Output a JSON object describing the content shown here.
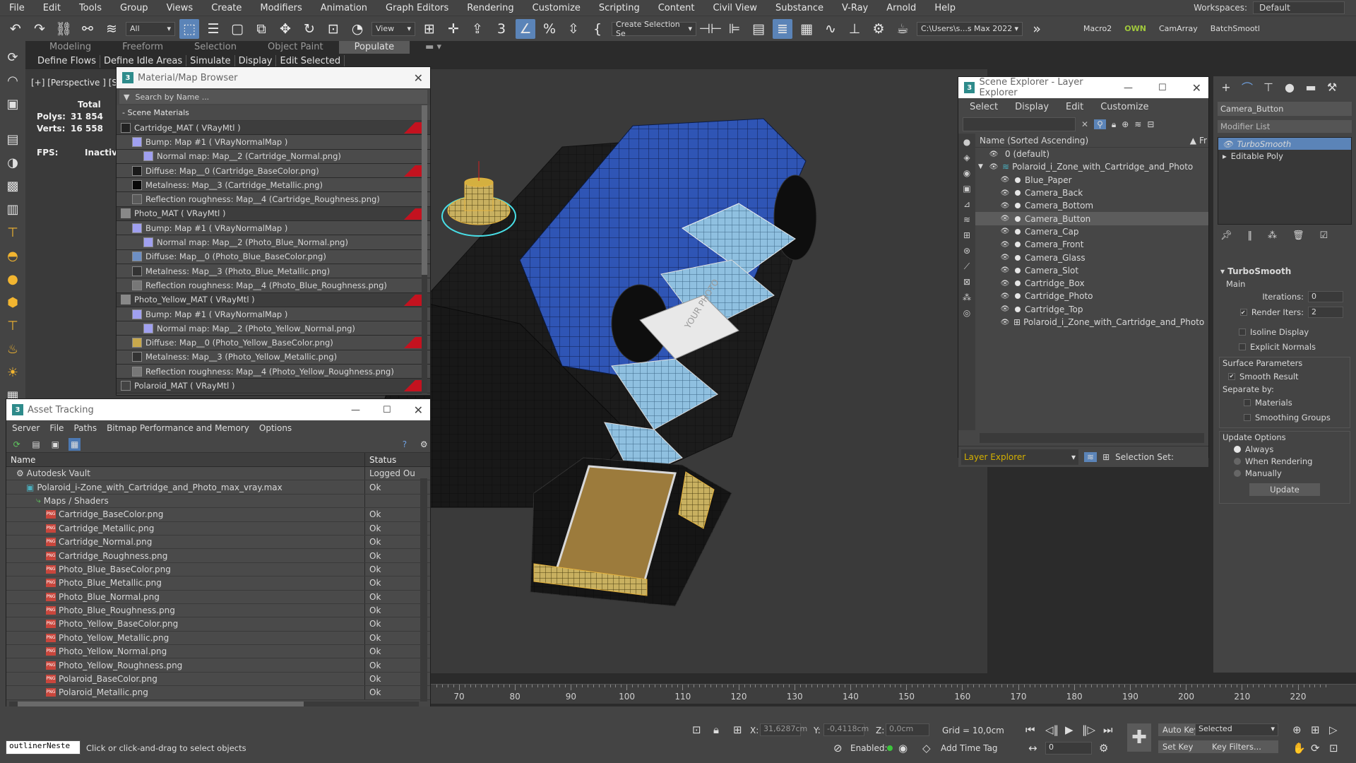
{
  "menubar": {
    "items": [
      "File",
      "Edit",
      "Tools",
      "Group",
      "Views",
      "Create",
      "Modifiers",
      "Animation",
      "Graph Editors",
      "Rendering",
      "Customize",
      "Scripting",
      "Content",
      "Civil View",
      "Substance",
      "V-Ray",
      "Arnold",
      "Help"
    ],
    "workspaces_label": "Workspaces:",
    "workspaces_value": "Default"
  },
  "toolbar": {
    "filter_value": "All",
    "view_value": "View",
    "selection_set": "Create Selection Se",
    "project_path": "C:\\Users\\s...s Max 2022",
    "macro2": "Macro2",
    "own": "OWN",
    "camarray": "CamArray",
    "batchsmooth": "BatchSmootl"
  },
  "ribbon": {
    "tabs": [
      "Modeling",
      "Freeform",
      "Selection",
      "Object Paint",
      "Populate"
    ],
    "sub_items": [
      "Define Flows",
      "Define Idle Areas",
      "Simulate",
      "Display",
      "Edit Selected"
    ]
  },
  "viewport": {
    "label": "[+] [Perspective ] [St",
    "stats": {
      "total_label": "Total",
      "polys_label": "Polys:",
      "polys_value": "31 854",
      "verts_label": "Verts:",
      "verts_value": "16 558",
      "fps_label": "FPS:",
      "fps_value": "Inactive"
    },
    "photo_text": "YOUR PHOTO"
  },
  "material_browser": {
    "title": "Material/Map Browser",
    "search_placeholder": "Search by Name ...",
    "group": "- Scene Materials",
    "rows": [
      {
        "text": "Cartridge_MAT  ( VRayMtl )",
        "indent": 0,
        "top": true,
        "swatch": "#222222",
        "tag": true
      },
      {
        "text": "Bump: Map #1  ( VRayNormalMap )",
        "indent": 1,
        "swatch": "#a0a0f0"
      },
      {
        "text": "Normal map: Map__2 (Cartridge_Normal.png)",
        "indent": 2,
        "swatch": "#a0a0f0"
      },
      {
        "text": "Diffuse: Map__0 (Cartridge_BaseColor.png)",
        "indent": 1,
        "swatch": "#1a1a1a",
        "tag": true
      },
      {
        "text": "Metalness: Map__3 (Cartridge_Metallic.png)",
        "indent": 1,
        "swatch": "#080808"
      },
      {
        "text": "Reflection roughness: Map__4 (Cartridge_Roughness.png)",
        "indent": 1,
        "swatch": "#5a5a5a"
      },
      {
        "text": "Photo_MAT  ( VRayMtl )",
        "indent": 0,
        "top": true,
        "swatch": "#888888",
        "tag": true
      },
      {
        "text": "Bump: Map #1  ( VRayNormalMap )",
        "indent": 1,
        "swatch": "#a0a0f0"
      },
      {
        "text": "Normal map: Map__2 (Photo_Blue_Normal.png)",
        "indent": 2,
        "swatch": "#a0a0f0"
      },
      {
        "text": "Diffuse: Map__0 (Photo_Blue_BaseColor.png)",
        "indent": 1,
        "swatch": "#6d8fc4"
      },
      {
        "text": "Metalness: Map__3 (Photo_Blue_Metallic.png)",
        "indent": 1,
        "swatch": "#333333"
      },
      {
        "text": "Reflection roughness: Map__4 (Photo_Blue_Roughness.png)",
        "indent": 1,
        "swatch": "#777777"
      },
      {
        "text": "Photo_Yellow_MAT  ( VRayMtl )",
        "indent": 0,
        "top": true,
        "swatch": "#888888",
        "tag": true
      },
      {
        "text": "Bump: Map #1  ( VRayNormalMap )",
        "indent": 1,
        "swatch": "#a0a0f0"
      },
      {
        "text": "Normal map: Map__2 (Photo_Yellow_Normal.png)",
        "indent": 2,
        "swatch": "#a0a0f0"
      },
      {
        "text": "Diffuse: Map__0 (Photo_Yellow_BaseColor.png)",
        "indent": 1,
        "swatch": "#c8a84c",
        "tag": true
      },
      {
        "text": "Metalness: Map__3 (Photo_Yellow_Metallic.png)",
        "indent": 1,
        "swatch": "#333333"
      },
      {
        "text": "Reflection roughness: Map__4 (Photo_Yellow_Roughness.png)",
        "indent": 1,
        "swatch": "#777777"
      },
      {
        "text": "Polaroid_MAT  ( VRayMtl )",
        "indent": 0,
        "top": true,
        "swatch": "#444444",
        "tag": true
      }
    ]
  },
  "asset_tracking": {
    "title": "Asset Tracking",
    "menu": [
      "Server",
      "File",
      "Paths",
      "Bitmap Performance and Memory",
      "Options"
    ],
    "col_name": "Name",
    "col_status": "Status",
    "rows": [
      {
        "name": "Autodesk Vault",
        "status": "Logged Ou",
        "indent": 1,
        "icon": "vault"
      },
      {
        "name": "Polaroid_i-Zone_with_Cartridge_and_Photo_max_vray.max",
        "status": "Ok",
        "indent": 2,
        "icon": "max"
      },
      {
        "name": "Maps / Shaders",
        "status": "",
        "indent": 3,
        "icon": "maps"
      },
      {
        "name": "Cartridge_BaseColor.png",
        "status": "Ok",
        "indent": 4,
        "icon": "png"
      },
      {
        "name": "Cartridge_Metallic.png",
        "status": "Ok",
        "indent": 4,
        "icon": "png"
      },
      {
        "name": "Cartridge_Normal.png",
        "status": "Ok",
        "indent": 4,
        "icon": "png"
      },
      {
        "name": "Cartridge_Roughness.png",
        "status": "Ok",
        "indent": 4,
        "icon": "png"
      },
      {
        "name": "Photo_Blue_BaseColor.png",
        "status": "Ok",
        "indent": 4,
        "icon": "png"
      },
      {
        "name": "Photo_Blue_Metallic.png",
        "status": "Ok",
        "indent": 4,
        "icon": "png"
      },
      {
        "name": "Photo_Blue_Normal.png",
        "status": "Ok",
        "indent": 4,
        "icon": "png"
      },
      {
        "name": "Photo_Blue_Roughness.png",
        "status": "Ok",
        "indent": 4,
        "icon": "png"
      },
      {
        "name": "Photo_Yellow_BaseColor.png",
        "status": "Ok",
        "indent": 4,
        "icon": "png"
      },
      {
        "name": "Photo_Yellow_Metallic.png",
        "status": "Ok",
        "indent": 4,
        "icon": "png"
      },
      {
        "name": "Photo_Yellow_Normal.png",
        "status": "Ok",
        "indent": 4,
        "icon": "png"
      },
      {
        "name": "Photo_Yellow_Roughness.png",
        "status": "Ok",
        "indent": 4,
        "icon": "png"
      },
      {
        "name": "Polaroid_BaseColor.png",
        "status": "Ok",
        "indent": 4,
        "icon": "png"
      },
      {
        "name": "Polaroid_Metallic.png",
        "status": "Ok",
        "indent": 4,
        "icon": "png"
      }
    ]
  },
  "scene_explorer": {
    "title": "Scene Explorer - Layer Explorer",
    "menu": [
      "Select",
      "Display",
      "Edit",
      "Customize"
    ],
    "column_header": "Name (Sorted Ascending)",
    "column_header2": "Fr",
    "rows": [
      {
        "name": "0 (default)",
        "level": 1,
        "selected": false,
        "type": "layer"
      },
      {
        "name": "Polaroid_i_Zone_with_Cartridge_and_Photo",
        "level": 1,
        "selected": false,
        "type": "layer-open"
      },
      {
        "name": "Blue_Paper",
        "level": 2,
        "selected": false,
        "type": "obj"
      },
      {
        "name": "Camera_Back",
        "level": 2,
        "selected": false,
        "type": "obj"
      },
      {
        "name": "Camera_Bottom",
        "level": 2,
        "selected": false,
        "type": "obj"
      },
      {
        "name": "Camera_Button",
        "level": 2,
        "selected": true,
        "type": "obj"
      },
      {
        "name": "Camera_Cap",
        "level": 2,
        "selected": false,
        "type": "obj"
      },
      {
        "name": "Camera_Front",
        "level": 2,
        "selected": false,
        "type": "obj"
      },
      {
        "name": "Camera_Glass",
        "level": 2,
        "selected": false,
        "type": "obj"
      },
      {
        "name": "Camera_Slot",
        "level": 2,
        "selected": false,
        "type": "obj"
      },
      {
        "name": "Cartridge_Box",
        "level": 2,
        "selected": false,
        "type": "obj"
      },
      {
        "name": "Cartridge_Photo",
        "level": 2,
        "selected": false,
        "type": "obj"
      },
      {
        "name": "Cartridge_Top",
        "level": 2,
        "selected": false,
        "type": "obj"
      },
      {
        "name": "Polaroid_i_Zone_with_Cartridge_and_Photo",
        "level": 2,
        "selected": false,
        "type": "group"
      }
    ],
    "footer_dropdown": "Layer Explorer",
    "selection_set_label": "Selection Set:"
  },
  "command_panel": {
    "object_name": "Camera_Button",
    "modifier_list": "Modifier List",
    "stack": [
      "TurboSmooth",
      "Editable Poly"
    ],
    "rollout_title": "TurboSmooth",
    "main_label": "Main",
    "iterations_label": "Iterations:",
    "iterations_value": "0",
    "render_iters_label": "Render Iters:",
    "render_iters_value": "2",
    "render_iters_checked": true,
    "isoline_label": "Isoline Display",
    "explicit_normals_label": "Explicit Normals",
    "surface_params_label": "Surface Parameters",
    "smooth_result_label": "Smooth Result",
    "separate_by_label": "Separate by:",
    "materials_label": "Materials",
    "smoothing_groups_label": "Smoothing Groups",
    "update_options_label": "Update Options",
    "always_label": "Always",
    "when_rendering_label": "When Rendering",
    "manually_label": "Manually",
    "update_button": "Update"
  },
  "timeline": {
    "ticks": [
      "70",
      "80",
      "90",
      "100",
      "110",
      "120",
      "130",
      "140",
      "150",
      "160",
      "170",
      "180",
      "190",
      "200",
      "210",
      "220"
    ]
  },
  "statusbar": {
    "script_listener": "outlinerNeste",
    "prompt": "Click or click-and-drag to select objects",
    "x_label": "X:",
    "x_value": "31,6287cm",
    "y_label": "Y:",
    "y_value": "-0,4118cm",
    "z_label": "Z:",
    "z_value": "0,0cm",
    "grid": "Grid = 10,0cm",
    "enabled_label": "Enabled:",
    "add_time_tag": "Add Time Tag",
    "frame_value": "0",
    "auto_key": "Auto Key",
    "set_key": "Set Key",
    "selected_value": "Selected",
    "key_filters": "Key Filters..."
  },
  "colors": {
    "accent_blue": "#5b84b8",
    "bg": "#444444",
    "viewport": "#3a3a3a",
    "model_blue": "#2f55b5",
    "selection_yellow": "#e5b23c",
    "layer_label_yellow": "#d4b000"
  }
}
